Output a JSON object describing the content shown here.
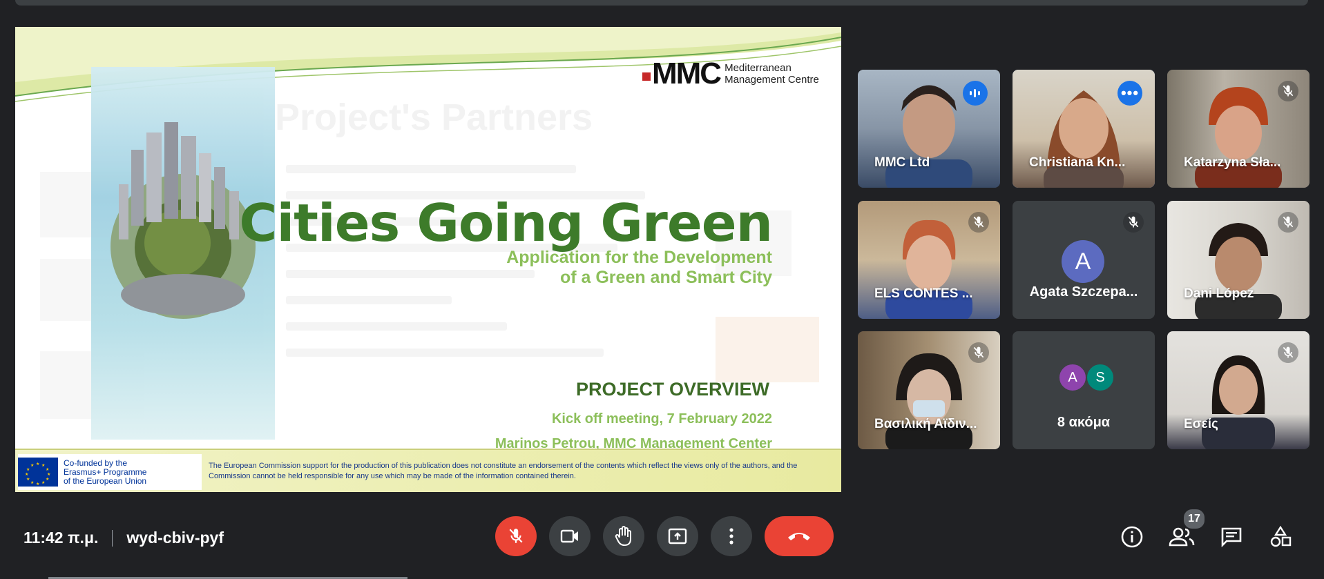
{
  "meeting": {
    "time": "11:42 π.μ.",
    "code": "wyd-cbiv-pyf",
    "participant_count": "17"
  },
  "slide": {
    "logo_main": "MMC",
    "logo_sub_1": "Mediterranean",
    "logo_sub_2": "Management Centre",
    "background_title": "Project's Partners",
    "title": "Cities Going Green",
    "subtitle_1": "Application for the Development",
    "subtitle_2": "of a Green and Smart City",
    "overview": "PROJECT OVERVIEW",
    "meeting_line": "Kick off meeting, 7 February 2022",
    "presenter_line": "Marinos Petrou, MMC Management Center",
    "eu_line_1": "Co-funded by the",
    "eu_line_2": "Erasmus+ Programme",
    "eu_line_3": "of the European Union",
    "disclaimer": "The European Commission support for the production of this publication does not constitute an endorsement of the contents which reflect the views only of the authors, and the Commission cannot be held responsible for any use which may be made of the information contained therein."
  },
  "participants": [
    {
      "name": "MMC Ltd",
      "status": "speaking"
    },
    {
      "name": "Christiana Kn...",
      "status": "more-options"
    },
    {
      "name": "Katarzyna Sła...",
      "status": "muted"
    },
    {
      "name": "ELS CONTES ...",
      "status": "muted"
    },
    {
      "name": "Agata Szczepa...",
      "avatar_letter": "A",
      "status": "muted"
    },
    {
      "name": "Dani López",
      "status": "muted"
    },
    {
      "name": "Βασιλική Αϊδιν...",
      "status": "muted"
    },
    {
      "name": "8 ακόμα",
      "avatar_letters": [
        "A",
        "S"
      ]
    },
    {
      "name": "Εσείς",
      "status": "muted"
    }
  ],
  "colors": {
    "background": "#202124",
    "tile": "#3c4043",
    "accent_blue": "#1a73e8",
    "danger_red": "#ea4335",
    "slide_green_dark": "#3d7b2a",
    "slide_green_light": "#8cbf5a"
  },
  "icons": {
    "controls": [
      "mic-off-icon",
      "camera-icon",
      "raise-hand-icon",
      "present-screen-icon",
      "more-options-icon",
      "end-call-icon"
    ],
    "right_controls": [
      "info-icon",
      "people-icon",
      "chat-icon",
      "activities-icon"
    ]
  }
}
